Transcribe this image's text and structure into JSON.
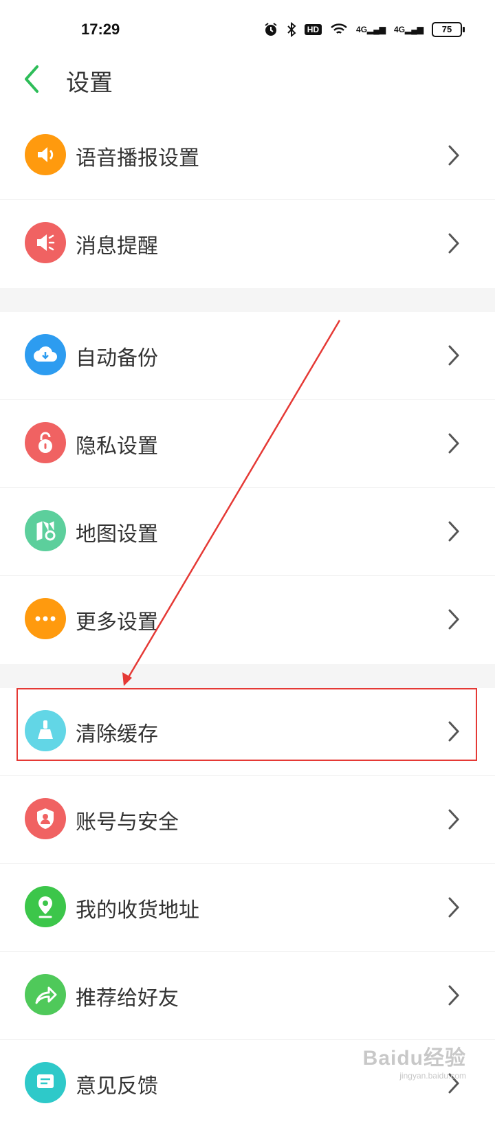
{
  "status_bar": {
    "time": "17:29",
    "hd_label": "HD",
    "signal1": "4G",
    "signal2": "4G",
    "battery": "75"
  },
  "header": {
    "title": "设置",
    "back_icon": "chevron-left-icon"
  },
  "colors": {
    "accent": "#2ebd59",
    "annotation": "#e53935"
  },
  "sections": [
    {
      "items": [
        {
          "label": "语音播报设置",
          "icon": "speaker-icon",
          "color": "#ff9a0e"
        },
        {
          "label": "消息提醒",
          "icon": "megaphone-icon",
          "color": "#f06262"
        }
      ]
    },
    {
      "items": [
        {
          "label": "自动备份",
          "icon": "cloud-download-icon",
          "color": "#2d9cf0"
        },
        {
          "label": "隐私设置",
          "icon": "lock-icon",
          "color": "#f06262"
        },
        {
          "label": "地图设置",
          "icon": "map-gear-icon",
          "color": "#5ccf9c"
        },
        {
          "label": "更多设置",
          "icon": "more-dots-icon",
          "color": "#ff9a0e"
        }
      ]
    },
    {
      "items": [
        {
          "label": "清除缓存",
          "icon": "broom-icon",
          "color": "#62d6e6"
        },
        {
          "label": "账号与安全",
          "icon": "shield-user-icon",
          "color": "#f06262"
        },
        {
          "label": "我的收货地址",
          "icon": "location-pin-icon",
          "color": "#3cc64a"
        },
        {
          "label": "推荐给好友",
          "icon": "share-arrow-icon",
          "color": "#4fc95a"
        },
        {
          "label": "意见反馈",
          "icon": "feedback-icon",
          "color": "#2ec9c9"
        }
      ]
    }
  ],
  "watermark": {
    "main": "Baidu经验",
    "sub": "jingyan.baidu.com"
  }
}
